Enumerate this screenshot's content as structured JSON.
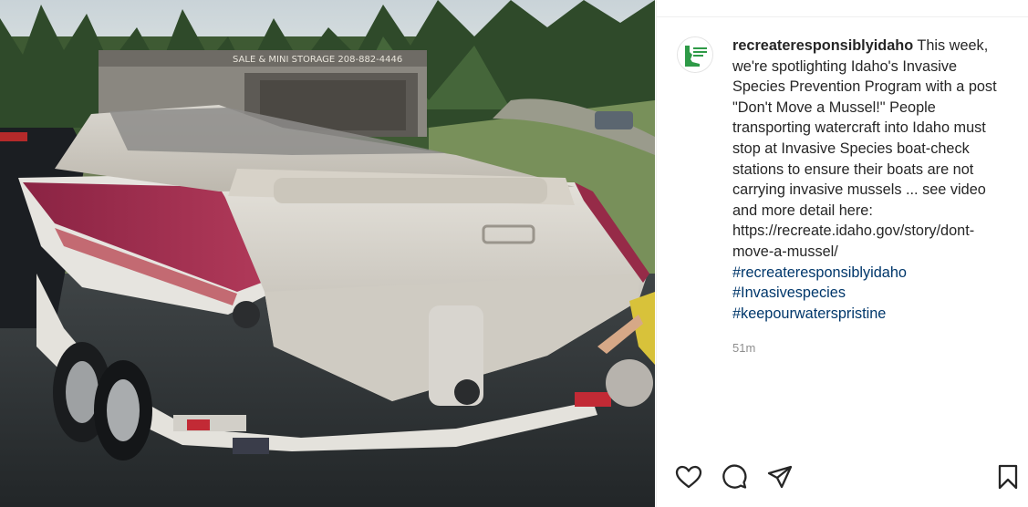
{
  "post": {
    "username": "recreateresponsiblyidaho",
    "caption_text": " This week, we're spotlighting Idaho's Invasive Species Prevention Program with a post \"Don't Move a Mussel!\" People transporting watercraft into Idaho must stop at Invasive Species boat-check stations to ensure their boats are not carrying invasive mussels ... see video and more detail here: https://recreate.idaho.gov/story/dont-move-a-mussel/",
    "hashtags": [
      "#recreateresponsiblyidaho",
      "#Invasivespecies",
      "#keepourwaterspristine"
    ],
    "timestamp": "51m",
    "avatar_logo_text": "RECREATE RESPONSIBLY IDAHO"
  },
  "media": {
    "sign_text": "SALE & MINI STORAGE 208-882-4446"
  },
  "actions": [
    {
      "name": "like",
      "icon": "heart-icon"
    },
    {
      "name": "comment",
      "icon": "comment-icon"
    },
    {
      "name": "share",
      "icon": "send-icon"
    },
    {
      "name": "save",
      "icon": "bookmark-icon"
    }
  ],
  "colors": {
    "link": "#00376b",
    "text": "#262626",
    "muted": "#8e8e8e",
    "brand_green": "#2e9a47"
  }
}
